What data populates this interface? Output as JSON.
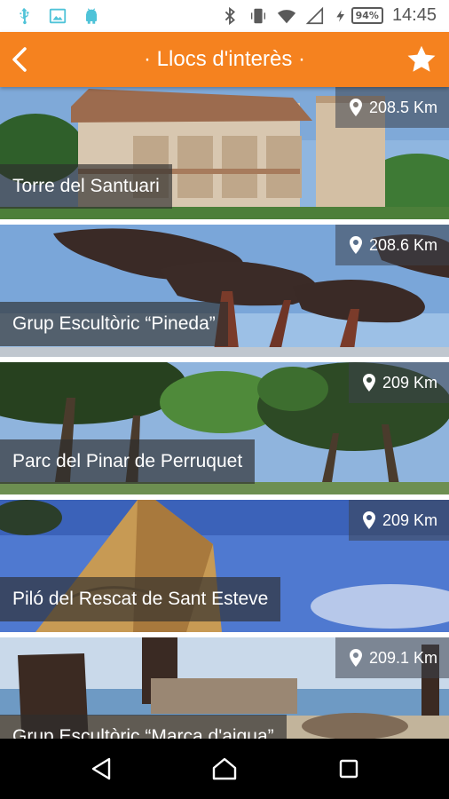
{
  "status_bar": {
    "time": "14:45",
    "battery": "94%",
    "left_icons": [
      "usb-icon",
      "image-icon",
      "android-icon"
    ],
    "right_icons": [
      "bluetooth-icon",
      "vibrate-icon",
      "wifi-icon",
      "signal-icon",
      "charging-icon",
      "battery-icon"
    ]
  },
  "app_bar": {
    "title": "· Llocs d'interès ·",
    "back_icon": "chevron-left-icon",
    "favorite_icon": "star-icon",
    "color": "#f5821f"
  },
  "places": [
    {
      "name": "Torre del Santuari",
      "distance": "208.5 Km"
    },
    {
      "name": "Grup Escultòric “Pineda”",
      "distance": "208.6 Km"
    },
    {
      "name": "Parc del Pinar de Perruquet",
      "distance": "209 Km"
    },
    {
      "name": "Piló del Rescat de Sant Esteve",
      "distance": "209 Km"
    },
    {
      "name": "Grup Escultòric “Marca d'aigua”",
      "distance": "209.1 Km"
    }
  ],
  "nav_bar": {
    "buttons": [
      "back-triangle-icon",
      "home-icon",
      "recents-icon"
    ]
  }
}
